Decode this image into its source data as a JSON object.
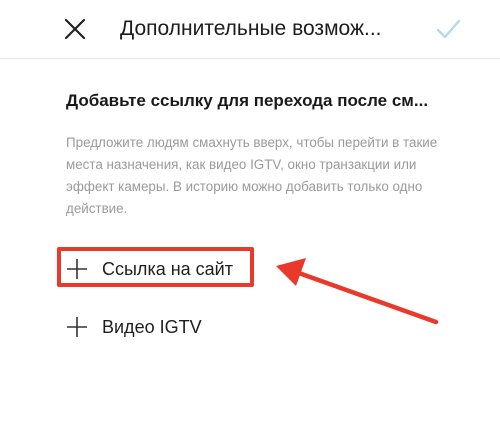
{
  "header": {
    "title": "Дополнительные возмож...",
    "close_icon": "close-icon",
    "confirm_icon": "check-icon"
  },
  "section": {
    "heading": "Добавьте ссылку для перехода после см...",
    "description": "Предложите людям смахнуть вверх, чтобы перейти в такие места назначения, как видео IGTV, окно транзакции или эффект камеры. В историю можно добавить только одно действие."
  },
  "actions": [
    {
      "label": "Ссылка на сайт",
      "icon": "plus-icon"
    },
    {
      "label": "Видео IGTV",
      "icon": "plus-icon"
    }
  ],
  "annotation": {
    "color": "#e8392b"
  },
  "colors": {
    "confirm_icon": "#b3d8f5",
    "description_text": "#9a9a9a"
  }
}
